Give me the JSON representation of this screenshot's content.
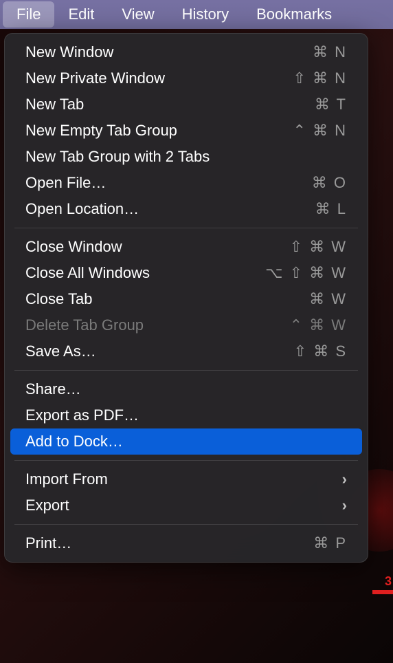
{
  "menubar": {
    "items": [
      {
        "label": "File",
        "active": true
      },
      {
        "label": "Edit",
        "active": false
      },
      {
        "label": "View",
        "active": false
      },
      {
        "label": "History",
        "active": false
      },
      {
        "label": "Bookmarks",
        "active": false
      }
    ]
  },
  "dropdown": {
    "groups": [
      [
        {
          "label": "New Window",
          "shortcut": "⌘ N",
          "disabled": false,
          "submenu": false,
          "highlighted": false
        },
        {
          "label": "New Private Window",
          "shortcut": "⇧ ⌘ N",
          "disabled": false,
          "submenu": false,
          "highlighted": false
        },
        {
          "label": "New Tab",
          "shortcut": "⌘ T",
          "disabled": false,
          "submenu": false,
          "highlighted": false
        },
        {
          "label": "New Empty Tab Group",
          "shortcut": "⌃ ⌘ N",
          "disabled": false,
          "submenu": false,
          "highlighted": false
        },
        {
          "label": "New Tab Group with 2 Tabs",
          "shortcut": "",
          "disabled": false,
          "submenu": false,
          "highlighted": false
        },
        {
          "label": "Open File…",
          "shortcut": "⌘ O",
          "disabled": false,
          "submenu": false,
          "highlighted": false
        },
        {
          "label": "Open Location…",
          "shortcut": "⌘ L",
          "disabled": false,
          "submenu": false,
          "highlighted": false
        }
      ],
      [
        {
          "label": "Close Window",
          "shortcut": "⇧ ⌘ W",
          "disabled": false,
          "submenu": false,
          "highlighted": false
        },
        {
          "label": "Close All Windows",
          "shortcut": "⌥ ⇧ ⌘ W",
          "disabled": false,
          "submenu": false,
          "highlighted": false
        },
        {
          "label": "Close Tab",
          "shortcut": "⌘ W",
          "disabled": false,
          "submenu": false,
          "highlighted": false
        },
        {
          "label": "Delete Tab Group",
          "shortcut": "⌃ ⌘ W",
          "disabled": true,
          "submenu": false,
          "highlighted": false
        },
        {
          "label": "Save As…",
          "shortcut": "⇧ ⌘ S",
          "disabled": false,
          "submenu": false,
          "highlighted": false
        }
      ],
      [
        {
          "label": "Share…",
          "shortcut": "",
          "disabled": false,
          "submenu": false,
          "highlighted": false
        },
        {
          "label": "Export as PDF…",
          "shortcut": "",
          "disabled": false,
          "submenu": false,
          "highlighted": false
        },
        {
          "label": "Add to Dock…",
          "shortcut": "",
          "disabled": false,
          "submenu": false,
          "highlighted": true
        }
      ],
      [
        {
          "label": "Import From",
          "shortcut": "",
          "disabled": false,
          "submenu": true,
          "highlighted": false
        },
        {
          "label": "Export",
          "shortcut": "",
          "disabled": false,
          "submenu": true,
          "highlighted": false
        }
      ],
      [
        {
          "label": "Print…",
          "shortcut": "⌘ P",
          "disabled": false,
          "submenu": false,
          "highlighted": false
        }
      ]
    ]
  }
}
